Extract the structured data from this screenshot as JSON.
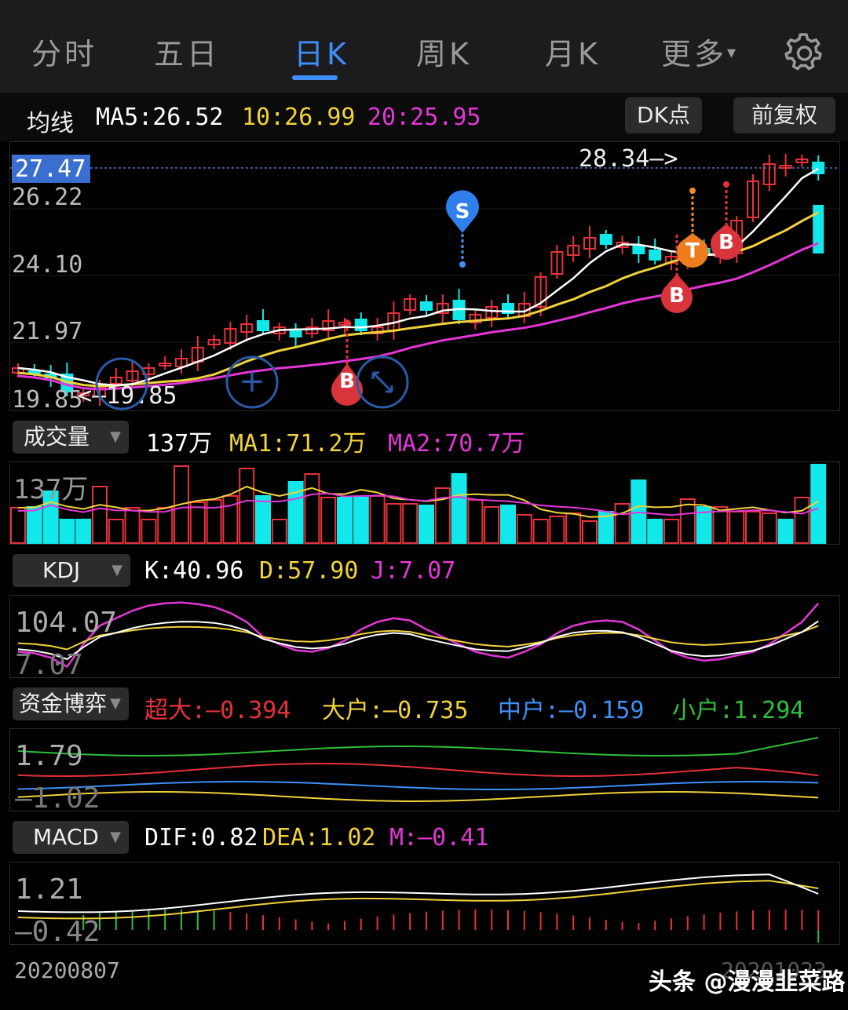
{
  "tabs": [
    "分时",
    "五日",
    "日K",
    "周K",
    "月K",
    "更多"
  ],
  "active_tab": "日K",
  "more_caret": "▾",
  "ma": {
    "label": "均线",
    "ma5": "MA5:26.52",
    "ma10": "10:26.99",
    "ma20": "20:25.95",
    "dk_button": "DK点",
    "fq_button": "前复权"
  },
  "price_panel": {
    "current_price_tag": "27.47",
    "y_labels": [
      "26.22",
      "24.10",
      "21.97",
      "19.85"
    ],
    "high_label": "28.34—>",
    "low_label": "<—19.85",
    "markers": [
      "S",
      "B",
      "B",
      "B",
      "T"
    ],
    "zoom_in_symbol": "+"
  },
  "volume": {
    "selector": "成交量",
    "value": "137万",
    "ma1": "MA1:71.2万",
    "ma2": "MA2:70.7万",
    "axis_label": "137万"
  },
  "kdj": {
    "selector": "KDJ",
    "k": "K:40.96",
    "d": "D:57.90",
    "j": "J:7.07",
    "axis_top": "104.07",
    "axis_bottom": "7.07"
  },
  "fund": {
    "selector": "资金博弈",
    "super": "超大:—0.394",
    "large": "大户:—0.735",
    "medium": "中户:—0.159",
    "small": "小户:1.294",
    "axis_top": "1.79",
    "axis_bottom": "—1.02"
  },
  "macd": {
    "selector": "MACD",
    "dif": "DIF:0.82",
    "dea": "DEA:1.02",
    "m": "M:—0.41",
    "axis_top": "1.21",
    "axis_bottom": "—0.42"
  },
  "footer": {
    "start_date": "20200807",
    "end_date": "20201023",
    "watermark": "头条 @漫漫韭菜路"
  },
  "colors": {
    "up": "#e8313a",
    "down": "#12e8ea",
    "ma5": "#ffffff",
    "ma10": "#f0d23a",
    "ma20": "#e436d6",
    "active": "#3e8ff7"
  }
}
